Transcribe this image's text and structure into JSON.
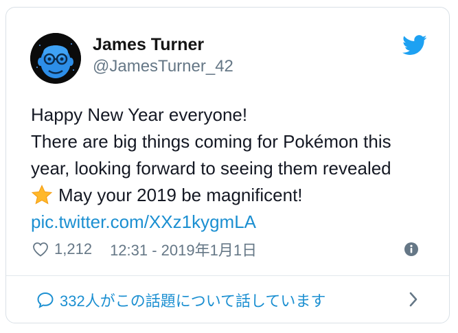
{
  "tweet": {
    "author_name": "James Turner",
    "author_handle": "@JamesTurner_42",
    "lines": [
      "Happy New Year everyone!",
      "There are big things coming for Pokémon this",
      "year, looking forward to seeing them revealed"
    ],
    "last_line": "May your 2019 be magnificent!",
    "link": "pic.twitter.com/XXz1kygmLA",
    "like_count": "1,212",
    "timestamp": "12:31 - 2019年1月1日",
    "conversation_label": "332人がこの話題について話しています"
  },
  "icons": {
    "avatar": "avatar-blue-face-icon",
    "brand": "twitter-bird-icon",
    "like": "heart-outline-icon",
    "info": "info-circle-icon",
    "reply": "speech-bubble-icon",
    "chevron": "chevron-right-icon",
    "emoji": "star-emoji-icon"
  },
  "colors": {
    "brand_blue": "#1da1f2",
    "link_blue": "#1b8fd1",
    "muted_gray": "#657786",
    "text_dark": "#141823",
    "star": "#ffb82a"
  }
}
